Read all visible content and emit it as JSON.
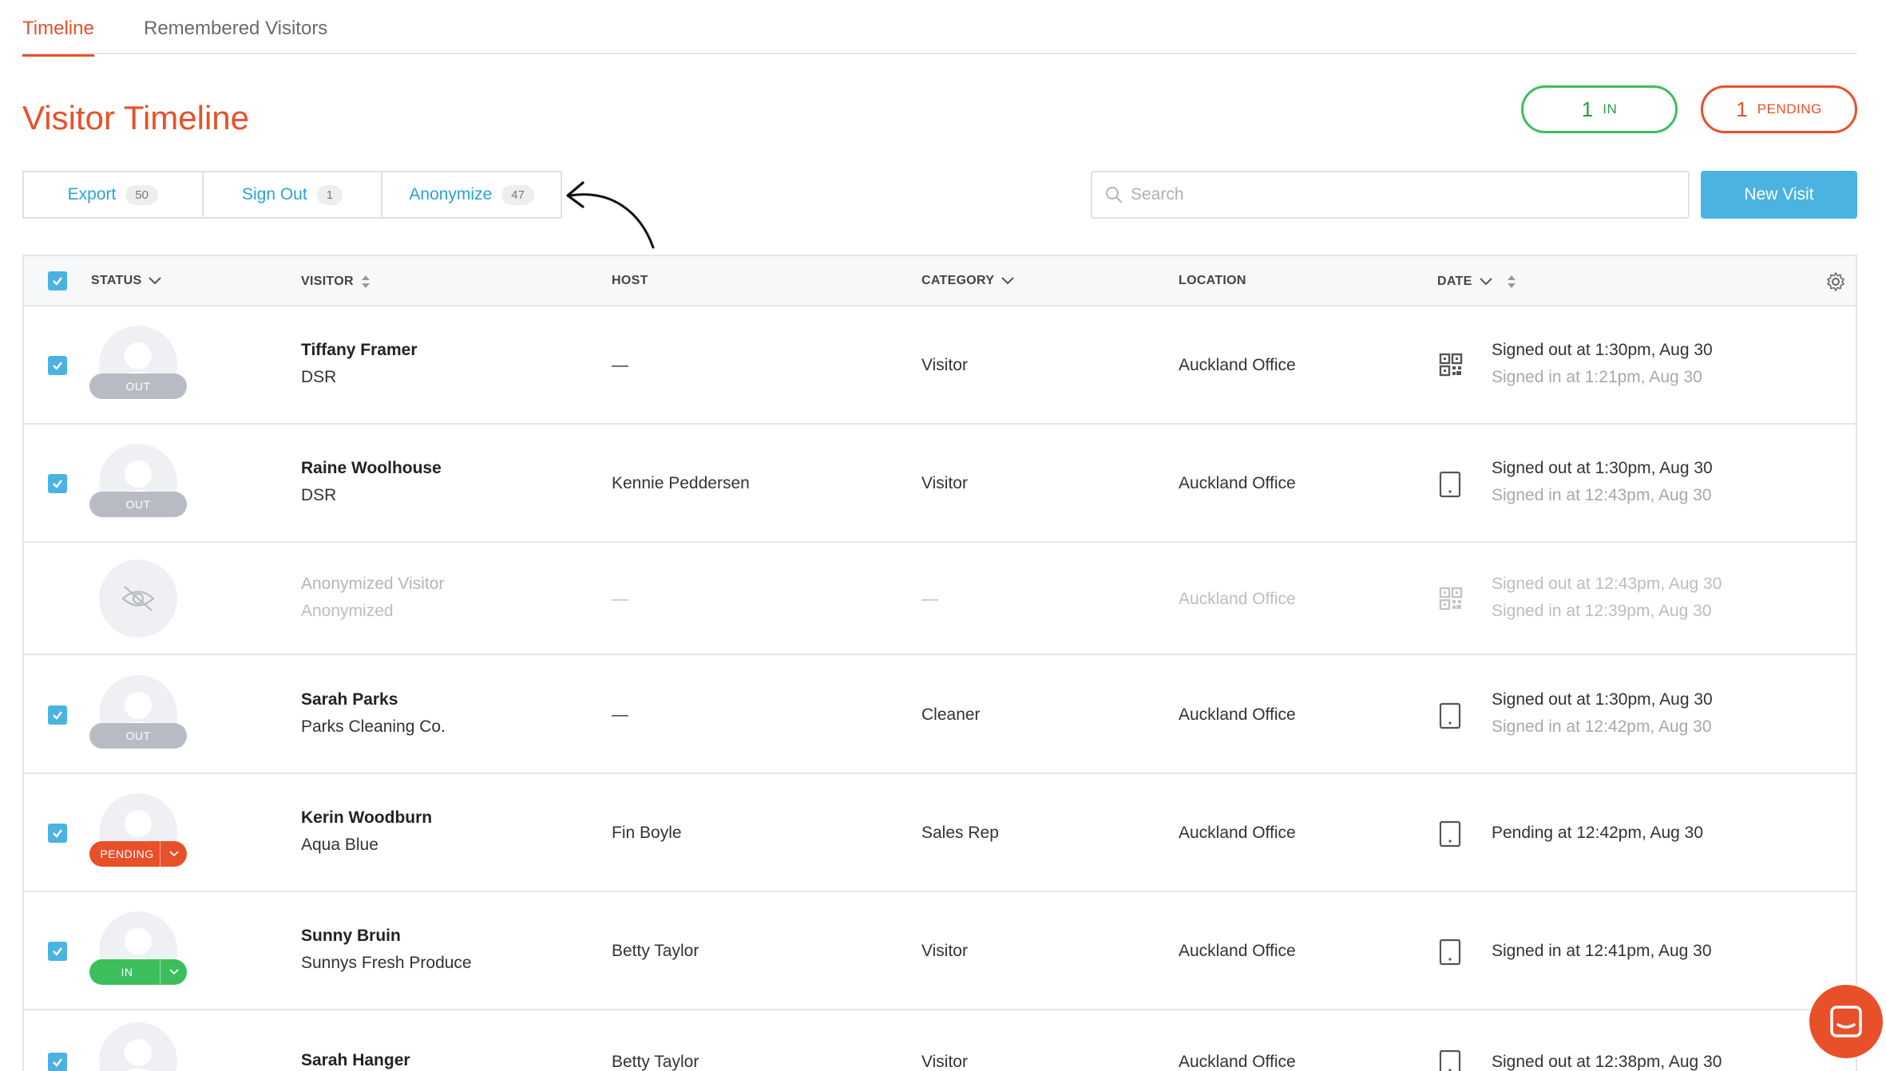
{
  "tabs": {
    "timeline": "Timeline",
    "remembered": "Remembered Visitors"
  },
  "page": {
    "title": "Visitor Timeline"
  },
  "counters": {
    "in": {
      "count": "1",
      "label": "IN"
    },
    "pending": {
      "count": "1",
      "label": "PENDING"
    }
  },
  "actions": {
    "export": {
      "label": "Export",
      "count": "50"
    },
    "signout": {
      "label": "Sign Out",
      "count": "1"
    },
    "anonymize": {
      "label": "Anonymize",
      "count": "47"
    }
  },
  "search": {
    "placeholder": "Search"
  },
  "new_visit": "New Visit",
  "columns": {
    "status": "STATUS",
    "visitor": "VISITOR",
    "host": "HOST",
    "category": "CATEGORY",
    "location": "LOCATION",
    "date": "DATE"
  },
  "rows": [
    {
      "name": "Tiffany Framer",
      "company": "DSR",
      "status": "OUT",
      "host": "—",
      "category": "Visitor",
      "location": "Auckland Office",
      "device": "qr-code",
      "line1": "Signed out at 1:30pm, Aug 30",
      "line2": "Signed in at 1:21pm, Aug 30"
    },
    {
      "name": "Raine Woolhouse",
      "company": "DSR",
      "status": "OUT",
      "host": "Kennie Peddersen",
      "category": "Visitor",
      "location": "Auckland Office",
      "device": "tablet",
      "line1": "Signed out at 1:30pm, Aug 30",
      "line2": "Signed in at 12:43pm, Aug 30"
    },
    {
      "name": "Anonymized Visitor",
      "company": "Anonymized",
      "status": "",
      "host": "—",
      "category": "—",
      "location": "Auckland Office",
      "device": "qr-code",
      "line1": "Signed out at 12:43pm, Aug 30",
      "line2": "Signed in at 12:39pm, Aug 30"
    },
    {
      "name": "Sarah Parks",
      "company": "Parks Cleaning Co.",
      "status": "OUT",
      "host": "—",
      "category": "Cleaner",
      "location": "Auckland Office",
      "device": "tablet",
      "line1": "Signed out at 1:30pm, Aug 30",
      "line2": "Signed in at 12:42pm, Aug 30"
    },
    {
      "name": "Kerin Woodburn",
      "company": "Aqua Blue",
      "status": "PENDING",
      "host": "Fin Boyle",
      "category": "Sales Rep",
      "location": "Auckland Office",
      "device": "tablet",
      "line1": "Pending at 12:42pm, Aug 30",
      "line2": ""
    },
    {
      "name": "Sunny Bruin",
      "company": "Sunnys Fresh Produce",
      "status": "IN",
      "host": "Betty Taylor",
      "category": "Visitor",
      "location": "Auckland Office",
      "device": "tablet",
      "line1": "Signed in at 12:41pm, Aug 30",
      "line2": ""
    },
    {
      "name": "Sarah Hanger",
      "company": "",
      "status": "",
      "host": "Betty Taylor",
      "category": "Visitor",
      "location": "Auckland Office",
      "device": "tablet",
      "line1": "Signed out at 12:38pm, Aug 30",
      "line2": ""
    }
  ],
  "colors": {
    "accent": "#e8502a",
    "in": "#3bbf5c",
    "link": "#29a3d6",
    "button": "#4ab3e2",
    "out_pill": "#b7bcc4"
  }
}
